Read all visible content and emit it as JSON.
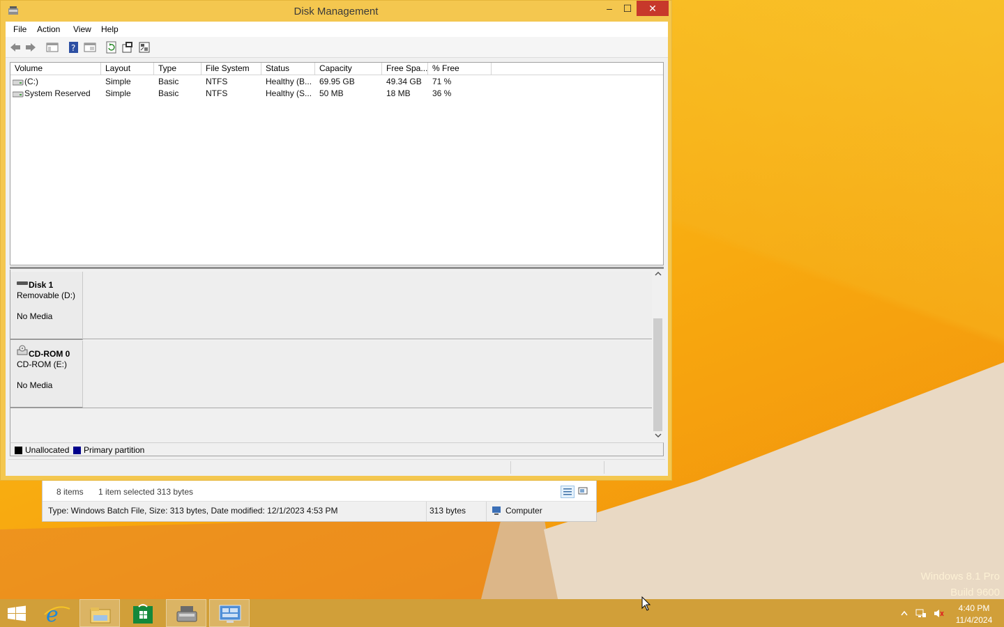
{
  "window": {
    "title": "Disk Management",
    "caption_min": "–",
    "caption_max": "☐",
    "caption_close": "✕"
  },
  "menu": [
    "File",
    "Action",
    "View",
    "Help"
  ],
  "toolbar_icons": [
    "back-arrow-icon",
    "forward-arrow-icon",
    "show-hide-console-tree-icon",
    "help-icon",
    "properties-view-icon",
    "refresh-icon",
    "export-list-icon",
    "rescan-disks-icon"
  ],
  "volume_list": {
    "columns": [
      "Volume",
      "Layout",
      "Type",
      "File System",
      "Status",
      "Capacity",
      "Free Spa...",
      "% Free"
    ],
    "rows": [
      [
        "(C:)",
        "Simple",
        "Basic",
        "NTFS",
        "Healthy (B...",
        "69.95 GB",
        "49.34 GB",
        "71 %"
      ],
      [
        "System Reserved",
        "Simple",
        "Basic",
        "NTFS",
        "Healthy (S...",
        "50 MB",
        "18 MB",
        "36 %"
      ]
    ]
  },
  "disks": [
    {
      "name": "Disk 1",
      "type": "Removable (D:)",
      "status": "No Media"
    },
    {
      "name": "CD-ROM 0",
      "type": "CD-ROM (E:)",
      "status": "No Media"
    }
  ],
  "legend": [
    {
      "label": "Unallocated",
      "color": "#000000"
    },
    {
      "label": "Primary partition",
      "color": "#00008b"
    }
  ],
  "explorer_status": {
    "items": "8 items",
    "selected": "1 item selected",
    "selected_size": "313 bytes",
    "details": "Type: Windows Batch File, Size: 313 bytes, Date modified: 12/1/2023 4:53 PM",
    "size": "313 bytes",
    "location": "Computer"
  },
  "watermark": {
    "line1": "Windows 8.1 Pro",
    "line2": "Build 9600"
  },
  "taskbar": {
    "apps": [
      "start-icon",
      "internet-explorer-icon",
      "file-explorer-icon",
      "store-icon",
      "disk-management-icon",
      "remote-desktop-icon"
    ],
    "time": "4:40 PM",
    "date": "11/4/2024"
  }
}
